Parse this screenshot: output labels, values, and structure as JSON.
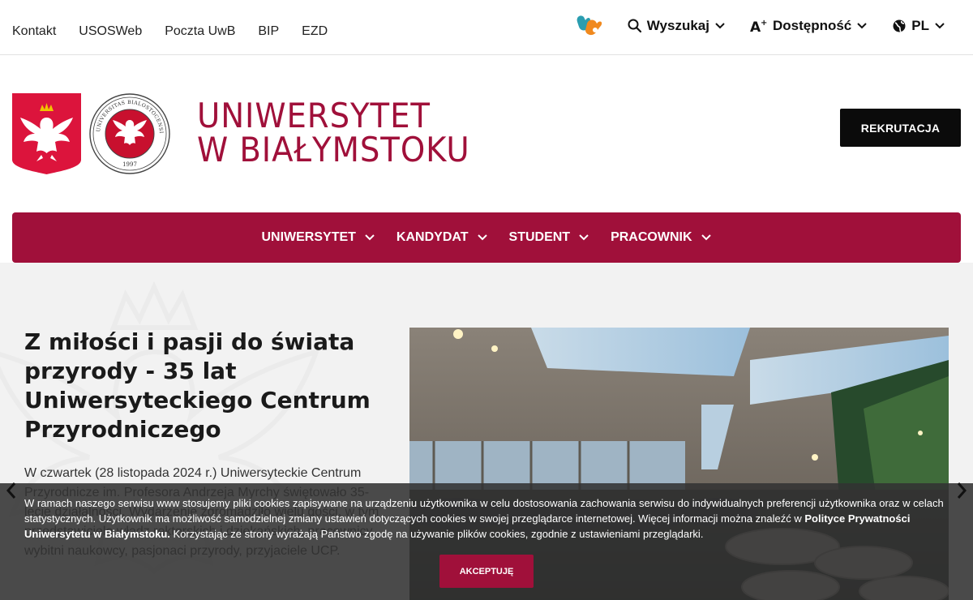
{
  "topbar": {
    "links": [
      "Kontakt",
      "USOSWeb",
      "Poczta UwB",
      "BIP",
      "EZD"
    ],
    "search_label": "Wyszukaj",
    "accessibility_label": "Dostępność",
    "language_label": "PL"
  },
  "header": {
    "name_line1": "UNIWERSYTET",
    "name_line2": "W BIAŁYMSTOKU",
    "recruitment_label": "REKRUTACJA",
    "seal_text": "UNIVERSITAS BIALOSTOCENSIS",
    "seal_year": "1997"
  },
  "nav": {
    "items": [
      "UNIWERSYTET",
      "KANDYDAT",
      "STUDENT",
      "PRACOWNIK"
    ]
  },
  "hero": {
    "title": "Z miłości i pasji do świata przyrody - 35 lat Uniwersyteckiego Centrum Przyrodniczego",
    "text": "W czwartek (28 listopada 2024 r.) Uniwersyteckie Centrum Przyrodnicze im. Profesora Andrzeja Myrchy świętowało 35-lecie działalności. Wydarzenie zgromadziło wielu gości, w tym przedstawiciele władz rektorskich i dziekańskich, pracownicy, wybitni naukowcy, pasjonaci przyrody, przyjaciele UCP."
  },
  "cookie": {
    "text_part1": "W ramach naszego serwisu www stosujemy pliki cookies zapisywane na urządzeniu użytkownika w celu dostosowania zachowania serwisu do indywidualnych preferencji użytkownika oraz w celach statystycznych. Użytkownik ma możliwość samodzielnej zmiany ustawień dotyczących cookies w swojej przeglądarce internetowej. Więcej informacji można znaleźć w ",
    "policy_link": "Polityce Prywatności Uniwersytetu w Białymstoku.",
    "text_part2": " Korzystając ze strony wyrażają Państwo zgodę na używanie plików cookies, zgodnie z ustawieniami przeglądarki.",
    "accept_label": "AKCEPTUJĘ"
  },
  "colors": {
    "brand": "#a0103a",
    "dark": "#0b0b0b",
    "hero_bg": "#f2f2f2"
  }
}
